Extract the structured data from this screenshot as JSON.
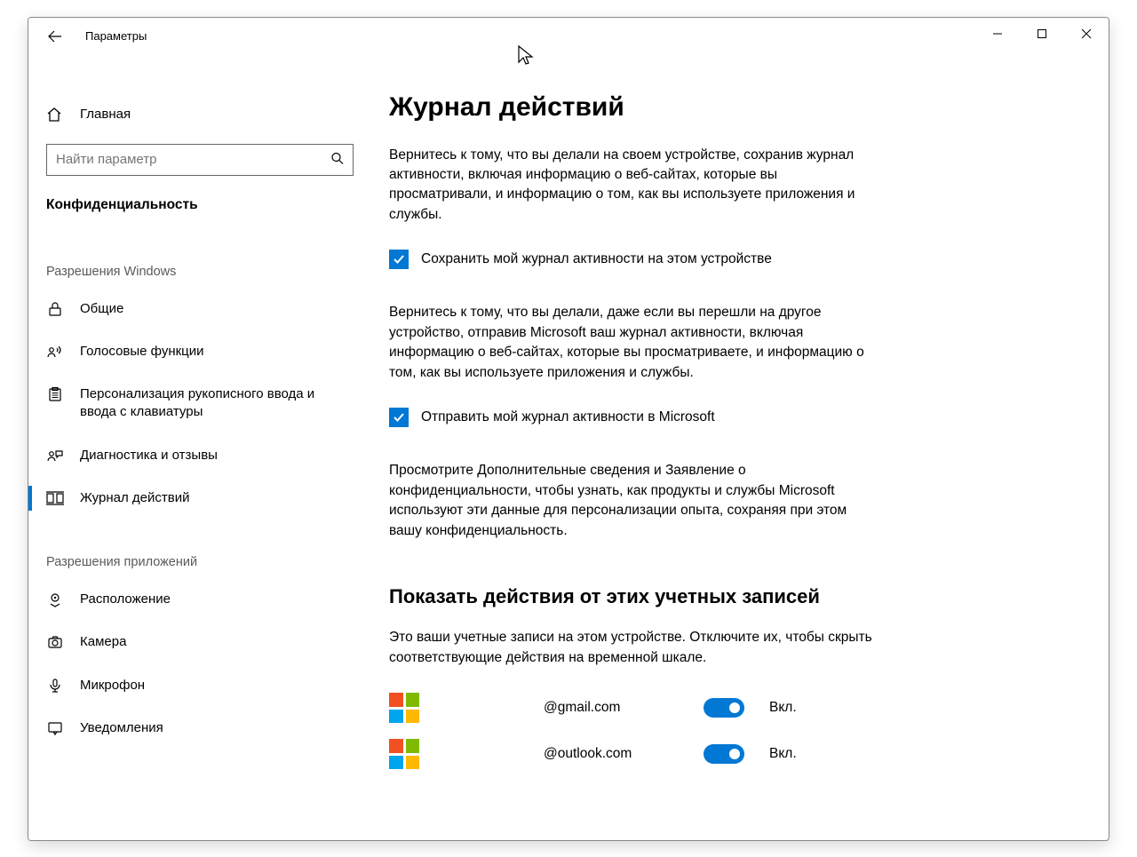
{
  "titlebar": {
    "title": "Параметры"
  },
  "sidebar": {
    "home_label": "Главная",
    "search_placeholder": "Найти параметр",
    "category": "Конфиденциальность",
    "section1_caption": "Разрешения Windows",
    "section1_items": [
      {
        "label": "Общие"
      },
      {
        "label": "Голосовые функции"
      },
      {
        "label": "Персонализация рукописного ввода и ввода с клавиатуры"
      },
      {
        "label": "Диагностика и отзывы"
      },
      {
        "label": "Журнал действий"
      }
    ],
    "section2_caption": "Разрешения приложений",
    "section2_items": [
      {
        "label": "Расположение"
      },
      {
        "label": "Камера"
      },
      {
        "label": "Микрофон"
      },
      {
        "label": "Уведомления"
      }
    ]
  },
  "main": {
    "heading": "Журнал действий",
    "para1": "Вернитесь к тому, что вы делали на своем устройстве, сохранив журнал активности, включая информацию о веб-сайтах, которые вы просматривали, и информацию о том, как вы используете приложения и службы.",
    "checkbox1_label": "Сохранить мой журнал активности на этом устройстве",
    "para2": "Вернитесь к тому, что вы делали, даже если вы перешли на другое устройство, отправив Microsoft ваш журнал активности, включая информацию о веб-сайтах, которые вы просматриваете, и информацию о том, как вы используете приложения и службы.",
    "checkbox2_label": "Отправить мой журнал активности в Microsoft",
    "para3": "Просмотрите Дополнительные сведения и Заявление о конфиденциальности, чтобы узнать, как продукты и службы Microsoft используют эти данные для персонализации опыта, сохраняя при этом вашу конфиденциальность.",
    "accounts_heading": "Показать действия от этих учетных записей",
    "accounts_desc": "Это ваши учетные записи на этом устройстве. Отключите их, чтобы скрыть соответствующие действия на временной шкале.",
    "accounts": [
      {
        "email": "@gmail.com",
        "state": "Вкл."
      },
      {
        "email": "@outlook.com",
        "state": "Вкл."
      }
    ]
  }
}
